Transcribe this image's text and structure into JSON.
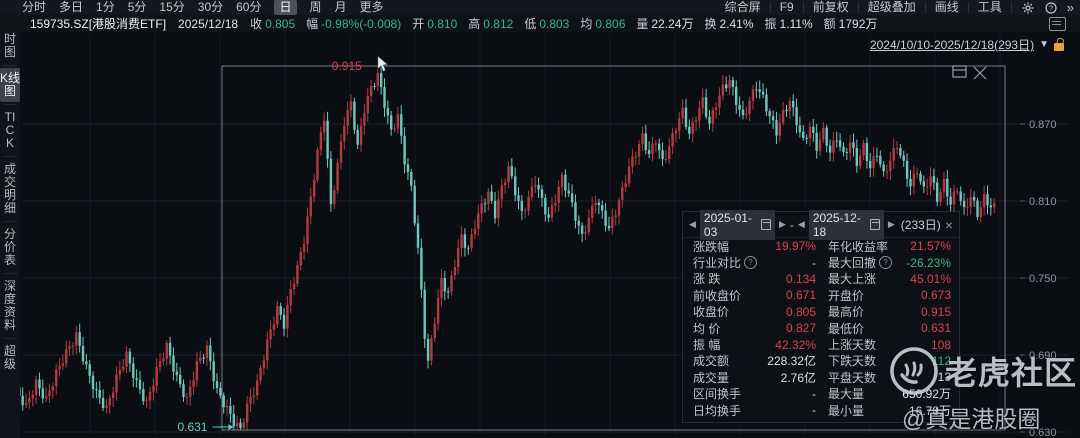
{
  "toolbar": {
    "left_items": [
      "分时",
      "多日",
      "1分",
      "5分",
      "15分",
      "30分",
      "60分",
      "日",
      "周",
      "月",
      "更多"
    ],
    "selected": "日",
    "right_items": [
      "综合屏",
      "F9",
      "前复权",
      "超级叠加",
      "画线",
      "工具"
    ],
    "more_icon": "»"
  },
  "stock_bar": {
    "symbol": "159735.SZ[港股消费ETF]",
    "date": "2025/12/18",
    "fields": [
      {
        "label": "收",
        "value": "0.805",
        "color": "green"
      },
      {
        "label": "幅",
        "value": "-0.98%(-0.008)",
        "color": "green"
      },
      {
        "label": "开",
        "value": "0.810",
        "color": "green"
      },
      {
        "label": "高",
        "value": "0.812",
        "color": "green"
      },
      {
        "label": "低",
        "value": "0.803",
        "color": "green"
      },
      {
        "label": "均",
        "value": "0.806",
        "color": "green"
      },
      {
        "label": "量",
        "value": "22.24万",
        "color": "white"
      },
      {
        "label": "换",
        "value": "2.41%",
        "color": "white"
      },
      {
        "label": "振",
        "value": "1.11%",
        "color": "white"
      },
      {
        "label": "额",
        "value": "1792万",
        "color": "white"
      }
    ]
  },
  "range_selector": {
    "text": "2024/10/10-2025/12/18(293日)"
  },
  "sidebar": {
    "items": [
      {
        "label": "分时图",
        "selected": false
      },
      {
        "label": "K线图",
        "selected": true
      },
      {
        "label": "TICK",
        "selected": false
      },
      {
        "label": "成交明细",
        "selected": false
      },
      {
        "label": "分价表",
        "selected": false
      },
      {
        "label": "深度资料",
        "selected": false
      },
      {
        "label": "超级",
        "selected": false
      }
    ]
  },
  "stats_panel": {
    "header": {
      "start_date": "2025-01-03",
      "end_date": "2025-12-18",
      "separator": "-",
      "days": "(233日)",
      "close": "×",
      "prev": "◀",
      "next": "▶"
    },
    "rows": [
      {
        "left": {
          "label": "涨跌幅",
          "value": "19.97%",
          "color": "red"
        },
        "right": {
          "label": "年化收益率",
          "value": "21.57%",
          "color": "red"
        }
      },
      {
        "left": {
          "label": "行业对比",
          "help": true,
          "value": "-",
          "color": "white"
        },
        "right": {
          "label": "最大回撤",
          "help": true,
          "value": "-26.23%",
          "color": "green"
        }
      },
      {
        "left": {
          "label": "涨 跌",
          "value": "0.134",
          "color": "red"
        },
        "right": {
          "label": "最大上涨",
          "value": "45.01%",
          "color": "red"
        }
      },
      {
        "left": {
          "label": "前收盘价",
          "value": "0.671",
          "color": "red"
        },
        "right": {
          "label": "开盘价",
          "value": "0.673",
          "color": "red"
        }
      },
      {
        "left": {
          "label": "收盘价",
          "value": "0.805",
          "color": "red"
        },
        "right": {
          "label": "最高价",
          "value": "0.915",
          "color": "red"
        }
      },
      {
        "left": {
          "label": "均 价",
          "value": "0.827",
          "color": "red"
        },
        "right": {
          "label": "最低价",
          "value": "0.631",
          "color": "red"
        }
      },
      {
        "left": {
          "label": "振 幅",
          "value": "42.32%",
          "color": "red"
        },
        "right": {
          "label": "上涨天数",
          "value": "108",
          "color": "red"
        }
      },
      {
        "left": {
          "label": "成交额",
          "value": "228.32亿",
          "color": "white"
        },
        "right": {
          "label": "下跌天数",
          "value": "112",
          "color": "green"
        }
      },
      {
        "left": {
          "label": "成交量",
          "value": "2.76亿",
          "color": "white"
        },
        "right": {
          "label": "平盘天数",
          "value": "13",
          "color": "white"
        }
      },
      {
        "left": {
          "label": "区间换手",
          "value": "-",
          "color": "white"
        },
        "right": {
          "label": "最大量",
          "value": "650.92万",
          "color": "white"
        }
      },
      {
        "left": {
          "label": "日均换手",
          "value": "-",
          "color": "white"
        },
        "right": {
          "label": "最小量",
          "value": "16.78万",
          "color": "white"
        }
      }
    ]
  },
  "watermark": {
    "brand": "老虎社区",
    "handle": "@真是港股圈"
  },
  "chart_data": {
    "type": "candlestick",
    "title": "159735.SZ 港股消费ETF 日K",
    "x_range": "2024/10/10 - 2025/12/18",
    "total_days": 293,
    "y_axis": [
      "0.870",
      "0.810",
      "0.750",
      "0.690",
      "0.630"
    ],
    "ylim": [
      0.62,
      0.925
    ],
    "high": {
      "label": "0.915",
      "day": 108,
      "price": 0.915
    },
    "low": {
      "label": "0.631",
      "day": 67,
      "price": 0.631
    },
    "selection": {
      "start_date": "2025-01-03",
      "end_date": "2025-12-18",
      "days": 233
    },
    "colors": {
      "up": "#b23b42",
      "down": "#6cc8bf",
      "grid": "#1a2128",
      "axis_text": "#8f969e",
      "box": "#767c84"
    },
    "anchors": [
      [
        0,
        0.662
      ],
      [
        3,
        0.65
      ],
      [
        6,
        0.668
      ],
      [
        9,
        0.655
      ],
      [
        12,
        0.676
      ],
      [
        15,
        0.692
      ],
      [
        18,
        0.705
      ],
      [
        21,
        0.68
      ],
      [
        24,
        0.66
      ],
      [
        27,
        0.648
      ],
      [
        30,
        0.672
      ],
      [
        33,
        0.69
      ],
      [
        36,
        0.668
      ],
      [
        39,
        0.652
      ],
      [
        42,
        0.678
      ],
      [
        45,
        0.697
      ],
      [
        48,
        0.672
      ],
      [
        51,
        0.655
      ],
      [
        54,
        0.683
      ],
      [
        57,
        0.695
      ],
      [
        60,
        0.662
      ],
      [
        63,
        0.648
      ],
      [
        65,
        0.638
      ],
      [
        67,
        0.632
      ],
      [
        69,
        0.65
      ],
      [
        72,
        0.668
      ],
      [
        75,
        0.7
      ],
      [
        78,
        0.726
      ],
      [
        80,
        0.714
      ],
      [
        82,
        0.74
      ],
      [
        84,
        0.758
      ],
      [
        86,
        0.78
      ],
      [
        88,
        0.812
      ],
      [
        90,
        0.848
      ],
      [
        92,
        0.876
      ],
      [
        94,
        0.806
      ],
      [
        96,
        0.838
      ],
      [
        98,
        0.872
      ],
      [
        100,
        0.886
      ],
      [
        102,
        0.852
      ],
      [
        104,
        0.882
      ],
      [
        106,
        0.898
      ],
      [
        108,
        0.908
      ],
      [
        110,
        0.886
      ],
      [
        112,
        0.864
      ],
      [
        114,
        0.876
      ],
      [
        116,
        0.842
      ],
      [
        118,
        0.82
      ],
      [
        120,
        0.772
      ],
      [
        122,
        0.706
      ],
      [
        123,
        0.684
      ],
      [
        125,
        0.718
      ],
      [
        127,
        0.748
      ],
      [
        129,
        0.738
      ],
      [
        131,
        0.762
      ],
      [
        133,
        0.782
      ],
      [
        135,
        0.772
      ],
      [
        137,
        0.792
      ],
      [
        139,
        0.806
      ],
      [
        141,
        0.816
      ],
      [
        143,
        0.8
      ],
      [
        145,
        0.82
      ],
      [
        147,
        0.836
      ],
      [
        149,
        0.818
      ],
      [
        151,
        0.8
      ],
      [
        153,
        0.812
      ],
      [
        155,
        0.826
      ],
      [
        157,
        0.81
      ],
      [
        159,
        0.796
      ],
      [
        161,
        0.812
      ],
      [
        163,
        0.828
      ],
      [
        165,
        0.815
      ],
      [
        167,
        0.798
      ],
      [
        169,
        0.782
      ],
      [
        171,
        0.796
      ],
      [
        173,
        0.812
      ],
      [
        175,
        0.8
      ],
      [
        177,
        0.788
      ],
      [
        179,
        0.802
      ],
      [
        181,
        0.818
      ],
      [
        183,
        0.836
      ],
      [
        185,
        0.848
      ],
      [
        187,
        0.86
      ],
      [
        189,
        0.846
      ],
      [
        191,
        0.858
      ],
      [
        193,
        0.84
      ],
      [
        195,
        0.852
      ],
      [
        197,
        0.868
      ],
      [
        199,
        0.88
      ],
      [
        201,
        0.862
      ],
      [
        203,
        0.876
      ],
      [
        205,
        0.888
      ],
      [
        207,
        0.87
      ],
      [
        209,
        0.886
      ],
      [
        211,
        0.898
      ],
      [
        213,
        0.904
      ],
      [
        215,
        0.888
      ],
      [
        217,
        0.874
      ],
      [
        219,
        0.888
      ],
      [
        221,
        0.9
      ],
      [
        223,
        0.89
      ],
      [
        225,
        0.876
      ],
      [
        227,
        0.864
      ],
      [
        229,
        0.878
      ],
      [
        231,
        0.888
      ],
      [
        233,
        0.872
      ],
      [
        235,
        0.856
      ],
      [
        237,
        0.868
      ],
      [
        239,
        0.852
      ],
      [
        241,
        0.864
      ],
      [
        243,
        0.848
      ],
      [
        245,
        0.86
      ],
      [
        247,
        0.845
      ],
      [
        249,
        0.856
      ],
      [
        251,
        0.84
      ],
      [
        253,
        0.852
      ],
      [
        255,
        0.836
      ],
      [
        257,
        0.848
      ],
      [
        259,
        0.83
      ],
      [
        261,
        0.842
      ],
      [
        263,
        0.854
      ],
      [
        265,
        0.838
      ],
      [
        267,
        0.822
      ],
      [
        269,
        0.834
      ],
      [
        271,
        0.818
      ],
      [
        273,
        0.83
      ],
      [
        275,
        0.812
      ],
      [
        277,
        0.824
      ],
      [
        279,
        0.808
      ],
      [
        281,
        0.82
      ],
      [
        283,
        0.802
      ],
      [
        285,
        0.814
      ],
      [
        287,
        0.8
      ],
      [
        289,
        0.812
      ],
      [
        291,
        0.806
      ],
      [
        292,
        0.805
      ]
    ]
  }
}
